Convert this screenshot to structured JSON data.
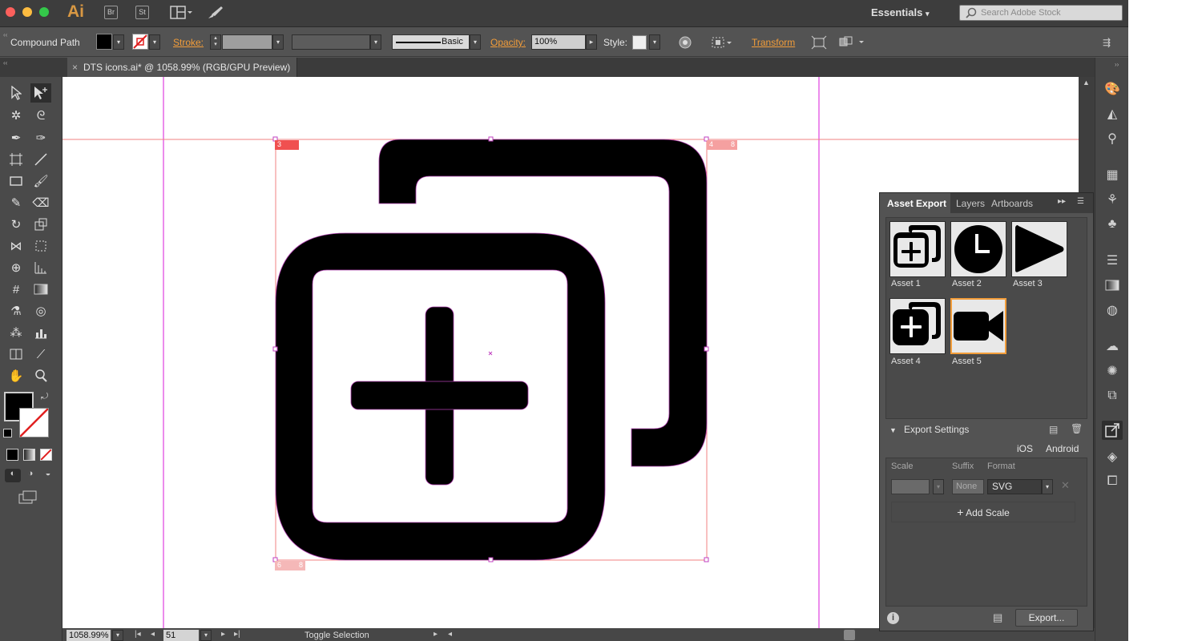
{
  "app": {
    "logo": "Ai",
    "bridge": "Br",
    "stock_app": "St",
    "workspace": "Essentials",
    "stock_search_placeholder": "Search Adobe Stock"
  },
  "control_bar": {
    "selection_type": "Compound Path",
    "stroke_label": "Stroke:",
    "brush_label": "Basic",
    "opacity_label": "Opacity:",
    "opacity_value": "100%",
    "style_label": "Style:",
    "transform_label": "Transform",
    "fill_color": "#000000"
  },
  "document": {
    "tab_title": "DTS icons.ai* @ 1058.99% (RGB/GPU Preview)",
    "close_glyph": "×"
  },
  "artboard_markers": {
    "top_left": "3",
    "top_right": "4",
    "top_right_2": "8",
    "bottom_left": "6",
    "bottom_left_2": "8"
  },
  "status_bar": {
    "zoom": "1058.99%",
    "artboard_number": "51",
    "status_text": "Toggle Selection"
  },
  "asset_panel": {
    "tabs": [
      "Asset Export",
      "Layers",
      "Artboards"
    ],
    "active_tab": "Asset Export",
    "assets": [
      {
        "label": "Asset 1",
        "icon": "copy-plus-icon",
        "selected": false
      },
      {
        "label": "Asset 2",
        "icon": "clock-icon",
        "selected": false
      },
      {
        "label": "Asset 3",
        "icon": "play-icon",
        "selected": false
      },
      {
        "label": "Asset 4",
        "icon": "copy-plus-filled-icon",
        "selected": false
      },
      {
        "label": "Asset 5",
        "icon": "video-camera-icon",
        "selected": true
      }
    ],
    "export_settings_label": "Export Settings",
    "ios_label": "iOS",
    "android_label": "Android",
    "scale_header": "Scale",
    "suffix_header": "Suffix",
    "format_header": "Format",
    "suffix_value": "None",
    "format_value": "SVG",
    "add_scale_label": "Add Scale",
    "export_button": "Export...",
    "accent_color": "#f29d3a"
  },
  "colors": {
    "guide_magenta": "#e040e0",
    "artboard_red": "#f05050"
  }
}
